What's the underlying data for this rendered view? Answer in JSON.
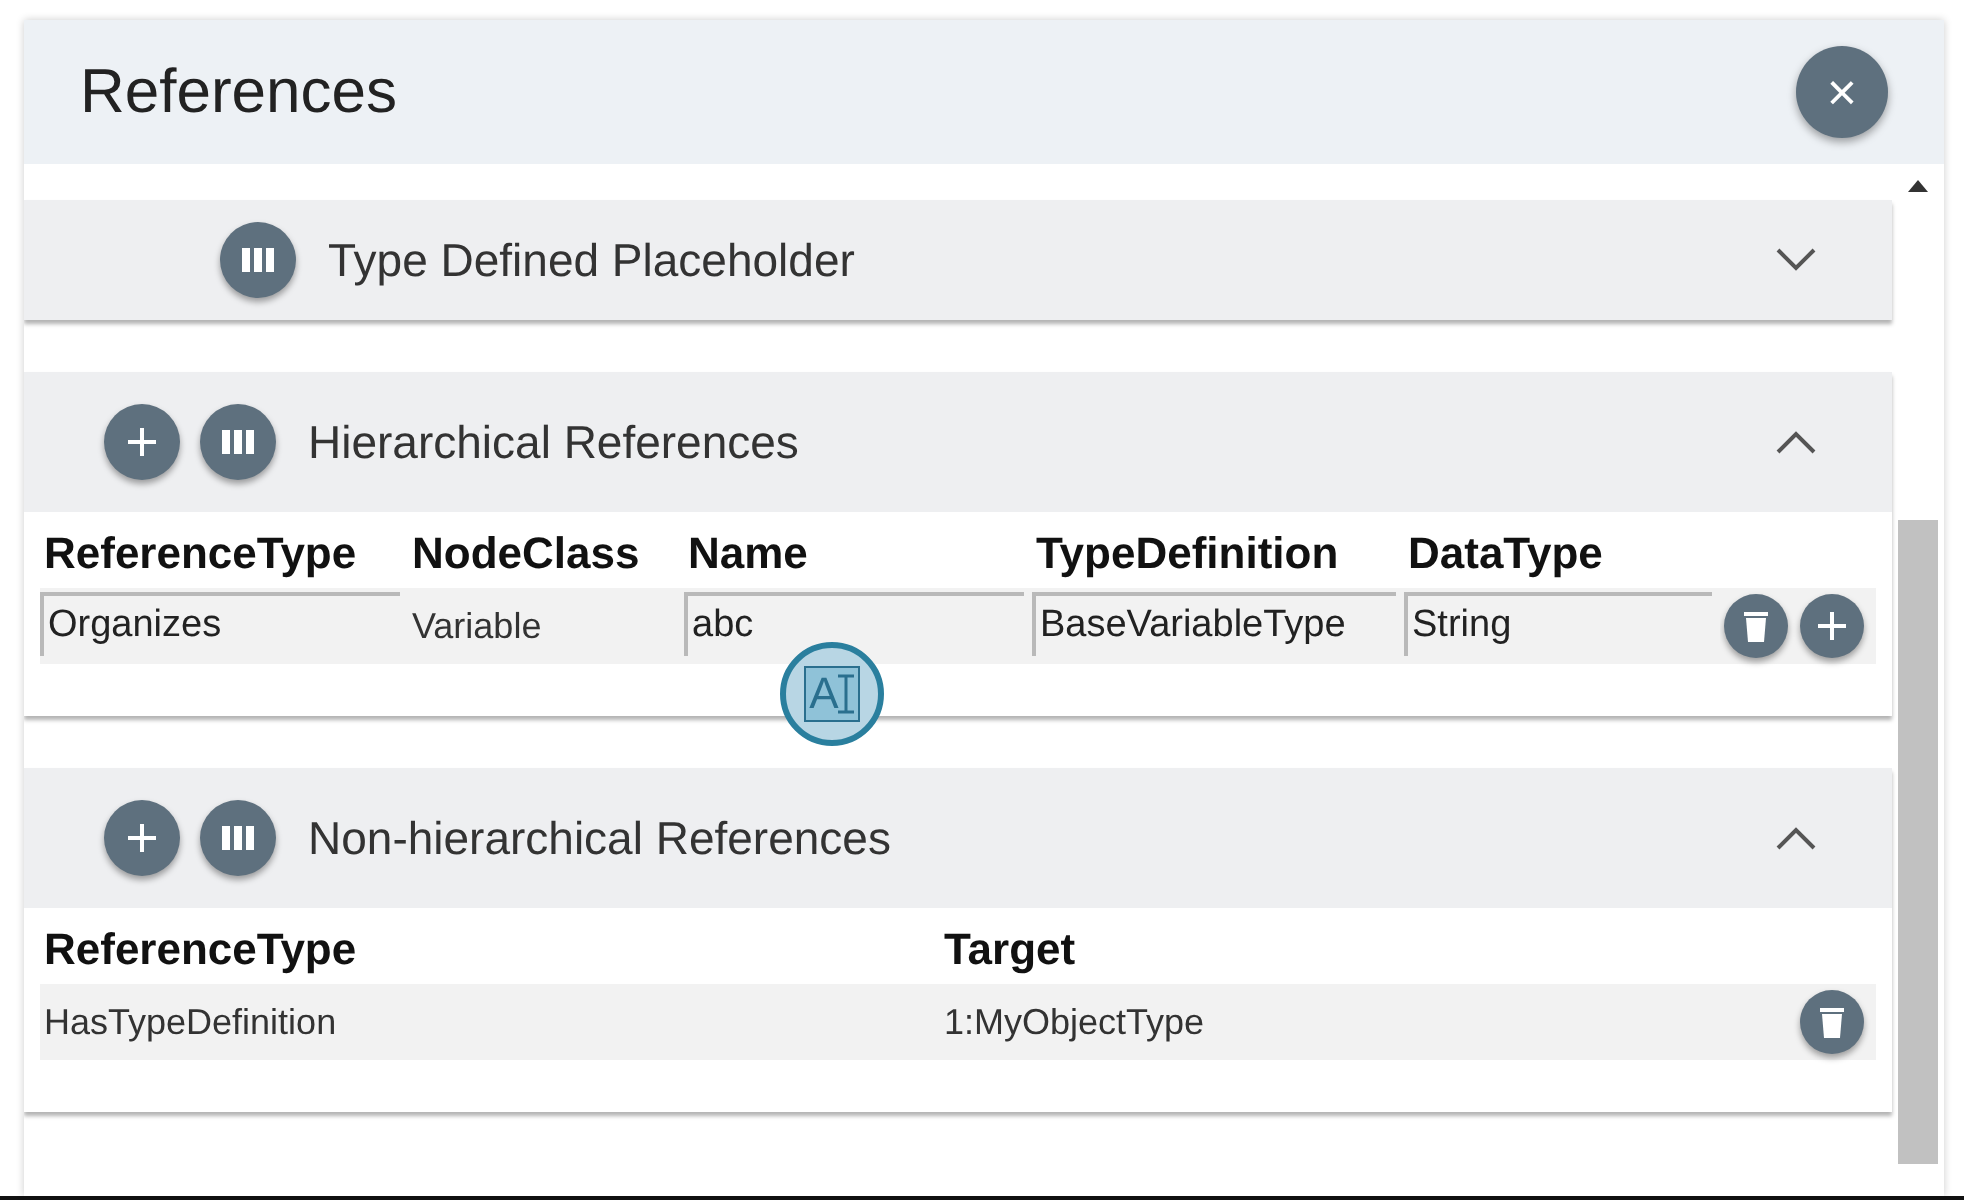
{
  "dialog": {
    "title": "References",
    "close_label": "×"
  },
  "sections": [
    {
      "title": "Type Defined Placeholder",
      "expanded": false,
      "can_add": false
    },
    {
      "title": "Hierarchical References",
      "expanded": true,
      "can_add": true,
      "columns": [
        "ReferenceType",
        "NodeClass",
        "Name",
        "TypeDefinition",
        "DataType"
      ],
      "rows": [
        {
          "cells": [
            {
              "kind": "field",
              "value": "Organizes"
            },
            {
              "kind": "text",
              "value": "Variable"
            },
            {
              "kind": "field",
              "value": "abc",
              "ime_badge": "A"
            },
            {
              "kind": "field",
              "value": "BaseVariableType"
            },
            {
              "kind": "field",
              "value": "String"
            }
          ],
          "can_add": true
        }
      ]
    },
    {
      "title": "Non-hierarchical References",
      "expanded": true,
      "can_add": true,
      "columns": [
        "ReferenceType",
        "Target"
      ],
      "rows": [
        {
          "cells": [
            {
              "kind": "text",
              "value": "HasTypeDefinition"
            },
            {
              "kind": "text",
              "value": "1:MyObjectType"
            }
          ],
          "can_add": false
        }
      ]
    }
  ]
}
